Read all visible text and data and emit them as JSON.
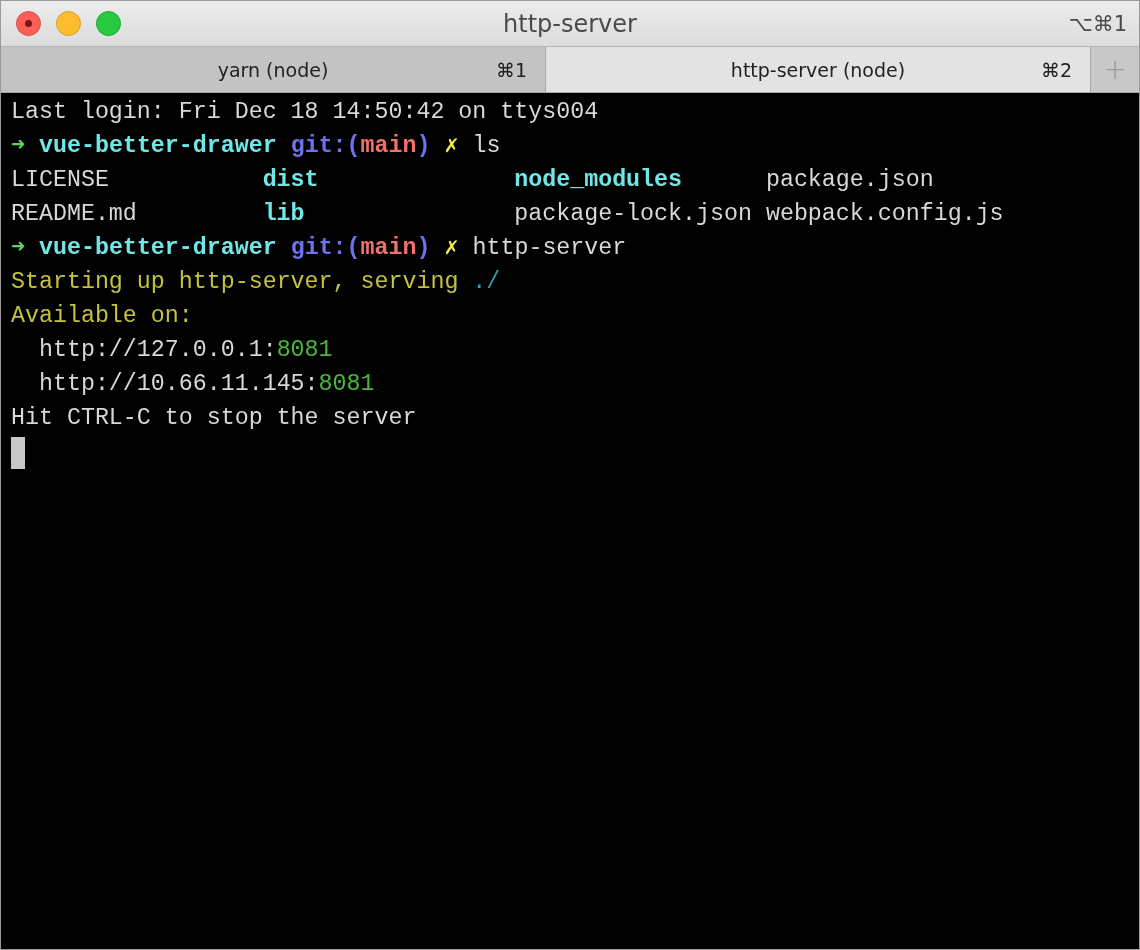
{
  "window": {
    "title": "http-server",
    "shortcut": "⌥⌘1"
  },
  "tabs": [
    {
      "label": "yarn (node)",
      "shortcut": "⌘1",
      "selected": false
    },
    {
      "label": "http-server (node)",
      "shortcut": "⌘2",
      "selected": true
    }
  ],
  "new_tab": "+",
  "terminal": {
    "lines": [
      {
        "kind": "plain",
        "segments": [
          {
            "kind": "normal",
            "text": "Last login: Fri Dec 18 14:50:42 on ttys004"
          }
        ]
      },
      {
        "kind": "prompt",
        "arrow": "➜",
        "dir": "vue-better-drawer",
        "git_open": "git:(",
        "branch": "main",
        "git_close": ")",
        "dirty": "✗",
        "command": "ls"
      },
      {
        "kind": "listing",
        "cells": [
          {
            "kind": "file",
            "text": "LICENSE"
          },
          {
            "kind": "dir",
            "text": "dist"
          },
          {
            "kind": "dir",
            "text": "node_modules"
          },
          {
            "kind": "file",
            "text": "package.json"
          }
        ]
      },
      {
        "kind": "listing",
        "cells": [
          {
            "kind": "file",
            "text": "README.md"
          },
          {
            "kind": "dir",
            "text": "lib"
          },
          {
            "kind": "file",
            "text": "package-lock.json"
          },
          {
            "kind": "file",
            "text": "webpack.config.js"
          }
        ]
      },
      {
        "kind": "prompt",
        "arrow": "➜",
        "dir": "vue-better-drawer",
        "git_open": "git:(",
        "branch": "main",
        "git_close": ")",
        "dirty": "✗",
        "command": "http-server"
      },
      {
        "kind": "plain",
        "segments": [
          {
            "kind": "yellow",
            "text": "Starting up http-server, serving "
          },
          {
            "kind": "path",
            "text": "./"
          }
        ]
      },
      {
        "kind": "plain",
        "segments": [
          {
            "kind": "yellow",
            "text": "Available on:"
          }
        ]
      },
      {
        "kind": "plain",
        "segments": [
          {
            "kind": "normal",
            "text": "  http://127.0.0.1:"
          },
          {
            "kind": "port",
            "text": "8081"
          }
        ]
      },
      {
        "kind": "plain",
        "segments": [
          {
            "kind": "normal",
            "text": "  http://10.66.11.145:"
          },
          {
            "kind": "port",
            "text": "8081"
          }
        ]
      },
      {
        "kind": "plain",
        "segments": [
          {
            "kind": "normal",
            "text": "Hit CTRL-C to stop the server"
          }
        ]
      }
    ],
    "cursor": true
  }
}
